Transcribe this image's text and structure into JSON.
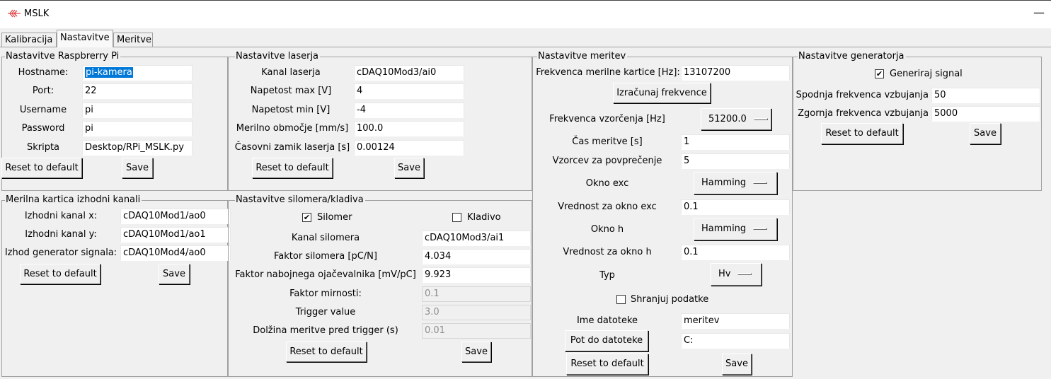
{
  "window": {
    "title": "MSLK",
    "minimize_glyph": "—"
  },
  "tabs": [
    {
      "label": "Kalibracija"
    },
    {
      "label": "Nastavitve"
    },
    {
      "label": "Meritve"
    }
  ],
  "rpi": {
    "title": "Nastavitve Raspbrerry Pi",
    "fields": [
      {
        "label": "Hostname:",
        "value": "pi-kamera"
      },
      {
        "label": "Port:",
        "value": "22"
      },
      {
        "label": "Username",
        "value": "pi"
      },
      {
        "label": "Password",
        "value": "pi"
      },
      {
        "label": "Skripta",
        "value": "Desktop/RPi_MSLK.py"
      }
    ],
    "reset_label": "Reset to default",
    "save_label": "Save"
  },
  "laser": {
    "title": "Nastavitve laserja",
    "fields": [
      {
        "label": "Kanal laserja",
        "value": "cDAQ10Mod3/ai0"
      },
      {
        "label": "Napetost max [V]",
        "value": "4"
      },
      {
        "label": "Napetost min [V]",
        "value": "-4"
      },
      {
        "label": "Merilno območje [mm/s]",
        "value": "100.0"
      },
      {
        "label": "Časovni zamik laserja [s]",
        "value": "0.00124"
      }
    ],
    "reset_label": "Reset to default",
    "save_label": "Save"
  },
  "outputs": {
    "title": "Merilna kartica izhodni kanali",
    "fields": [
      {
        "label": "Izhodni kanal x:",
        "value": "cDAQ10Mod1/ao0"
      },
      {
        "label": "Izhodni kanal y:",
        "value": "cDAQ10Mod1/ao1"
      },
      {
        "label": "Izhod generator signala:",
        "value": "cDAQ10Mod4/ao0"
      }
    ],
    "reset_label": "Reset to default",
    "save_label": "Save"
  },
  "silomer": {
    "title": "Nastavitve silomera/kladiva",
    "check_silomer": {
      "label": "Silomer",
      "checked": true,
      "mark": "✔"
    },
    "check_kladivo": {
      "label": "Kladivo",
      "checked": false
    },
    "fields": [
      {
        "label": "Kanal silomera",
        "value": "cDAQ10Mod3/ai1",
        "disabled": false
      },
      {
        "label": "Faktor silomera [pC/N]",
        "value": "4.034",
        "disabled": false
      },
      {
        "label": "Faktor nabojnega ojačevalnika [mV/pC]",
        "value": "9.923",
        "disabled": false
      },
      {
        "label": "Faktor mirnosti:",
        "value": "0.1",
        "disabled": true
      },
      {
        "label": "Trigger value",
        "value": "3.0",
        "disabled": true
      },
      {
        "label": "Dolžina meritve pred trigger (s)",
        "value": "0.01",
        "disabled": true
      }
    ],
    "reset_label": "Reset to default",
    "save_label": "Save"
  },
  "meritev": {
    "title": "Nastavitve meritev",
    "freq_label": "Frekvenca merilne kartice [Hz]:",
    "freq_value": "13107200",
    "calc_button": "Izračunaj frekvence",
    "sample_label": "Frekvenca vzorčenja [Hz]",
    "sample_value": "51200.0",
    "time_label": "Čas meritve [s]",
    "time_value": "1",
    "avg_label": "Vzorcev za povprečenje",
    "avg_value": "5",
    "win_exc_label": "Okno exc",
    "win_exc_value": "Hamming",
    "win_exc_val_label": "Vrednost za okno exc",
    "win_exc_val_value": "0.1",
    "win_h_label": "Okno h",
    "win_h_value": "Hamming",
    "win_h_val_label": "Vrednost za okno h",
    "win_h_val_value": "0.1",
    "typ_label": "Typ",
    "typ_value": "Hv",
    "save_data": {
      "label": "Shranjuj podatke",
      "checked": false
    },
    "filename_label": "Ime datoteke",
    "filename_value": "meritev",
    "path_button": "Pot do datoteke",
    "path_value": "C:",
    "reset_label": "Reset to default",
    "save_label": "Save"
  },
  "generator": {
    "title": "Nastavitve generatorja",
    "check_gen": {
      "label": "Generiraj signal",
      "checked": true,
      "mark": "✔"
    },
    "low_label": "Spodnja frekvenca vzbujanja",
    "low_value": "50",
    "high_label": "Zgornja frekvenca vzbujanja",
    "high_value": "5000",
    "reset_label": "Reset to default",
    "save_label": "Save"
  }
}
